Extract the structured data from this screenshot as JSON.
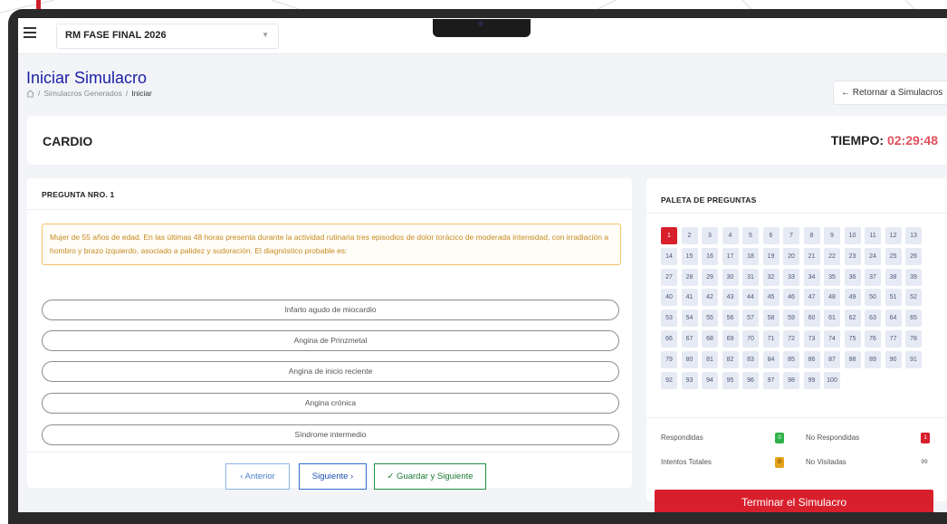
{
  "colors": {
    "accent": "#1b1fa5",
    "danger": "#d81f2c",
    "success": "#1e8e3e",
    "timer": "#e0505a"
  },
  "topbar": {
    "exam_select_value": "RM FASE FINAL 2026"
  },
  "header": {
    "title": "Iniciar Simulacro",
    "breadcrumb": [
      {
        "label": "Simulacros Generados"
      },
      {
        "label": "Iniciar"
      }
    ],
    "back_button": "← Retornar a Simulacros"
  },
  "exam": {
    "subject": "CARDIO",
    "timer_label": "TIEMPO: ",
    "timer_value": "02:29:48"
  },
  "question": {
    "heading": "PREGUNTA NRO. 1",
    "text": "Mujer de 55 años de edad. En las últimas 48 horas presenta durante la actividad rutinaria tres episodios de dolor torácico de moderada intensidad, con irradiación a hombro y brazo izquierdo, asociado a palidez y sudoración. El diagnóstico probable es:",
    "options": [
      "Infarto agudo de miocardio",
      "Angina de Prinzmetal",
      "Angina de inicio reciente",
      "Angina crónica",
      "Síndrome intermedio"
    ]
  },
  "buttons": {
    "prev": "‹ Anterior",
    "next": "Siguiente ›",
    "save": "✓ Guardar y Siguiente"
  },
  "palette": {
    "heading": "PALETA DE PREGUNTAS",
    "total": 100,
    "current": 1,
    "legend": {
      "respondidas_label": "Respondidas",
      "respondidas_count": "0",
      "no_respondidas_label": "No Respondidas",
      "no_respondidas_count": "1",
      "intentos_label": "Intentos Totales",
      "intentos_count": "0",
      "no_visitadas_label": "No Visitadas",
      "no_visitadas_count": "99"
    },
    "finish_button": "Terminar el Simulacro"
  }
}
